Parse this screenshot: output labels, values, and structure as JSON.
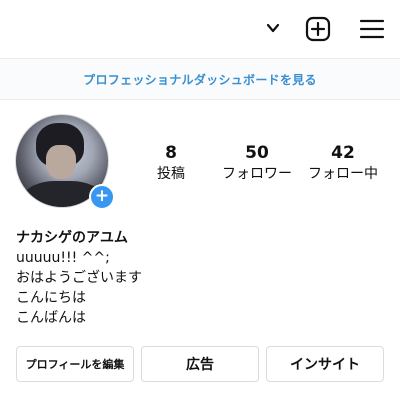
{
  "topbar": {
    "chevron_icon": "chevron-down-icon",
    "new_post_icon": "plus-square-icon",
    "menu_icon": "hamburger-menu-icon"
  },
  "dashboard_banner": {
    "label": "プロフェッショナルダッシュボードを見る",
    "color": "#3a8fd0"
  },
  "profile": {
    "avatar_badge": "+",
    "stats": {
      "posts": {
        "value": "8",
        "label": "投稿"
      },
      "followers": {
        "value": "50",
        "label": "フォロワー"
      },
      "following": {
        "value": "42",
        "label": "フォロー中"
      }
    },
    "name": "ナカシゲのアユム",
    "bio_lines": [
      "uuuuu!!! ^^;",
      "おはようございます",
      "こんにちは",
      "こんばんは"
    ]
  },
  "actions": {
    "edit_profile": "プロフィールを編集",
    "ads": "広告",
    "insights": "インサイト"
  },
  "colors": {
    "accent": "#3897f0",
    "border": "#dbdbdb"
  }
}
